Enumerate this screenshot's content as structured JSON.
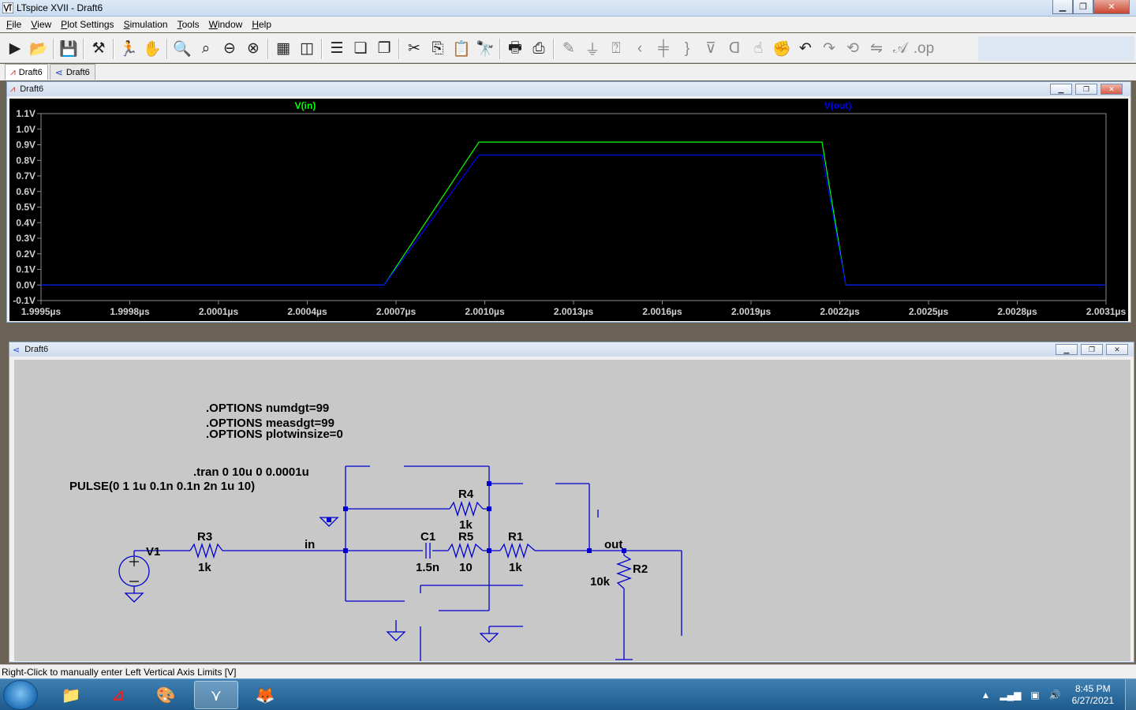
{
  "window": {
    "title": "LTspice XVII - Draft6"
  },
  "menu": [
    {
      "label": "File",
      "key": "F",
      "rest": "ile"
    },
    {
      "label": "View",
      "key": "V",
      "rest": "iew"
    },
    {
      "label": "Plot Settings",
      "key": "P",
      "rest": "lot Settings"
    },
    {
      "label": "Simulation",
      "key": "S",
      "rest": "imulation"
    },
    {
      "label": "Tools",
      "key": "T",
      "rest": "ools"
    },
    {
      "label": "Window",
      "key": "W",
      "rest": "indow"
    },
    {
      "label": "Help",
      "key": "H",
      "rest": "elp"
    }
  ],
  "tabs": [
    {
      "label": "Draft6",
      "icon": "waveform-icon",
      "active": true
    },
    {
      "label": "Draft6",
      "icon": "schematic-icon",
      "active": false
    }
  ],
  "waveform_window": {
    "title": "Draft6"
  },
  "schematic_window": {
    "title": "Draft6"
  },
  "chart_data": {
    "type": "line",
    "title": "",
    "xlabel": "",
    "ylabel": "",
    "series": [
      {
        "name": "V(in)",
        "color": "#00ff00",
        "x": [
          1.9995,
          2.00066,
          2.00098,
          2.00214,
          2.00222,
          2.0031
        ],
        "y": [
          0.0,
          0.0,
          0.917,
          0.917,
          0.0,
          0.0
        ]
      },
      {
        "name": "V(out)",
        "color": "#0000ff",
        "x": [
          1.9995,
          2.00066,
          2.00098,
          2.00214,
          2.00222,
          2.0031
        ],
        "y": [
          0.0,
          0.0,
          0.834,
          0.834,
          0.0,
          0.0
        ]
      }
    ],
    "xlim": [
      1.9995,
      2.0031
    ],
    "ylim": [
      -0.1,
      1.1
    ],
    "x_ticks": [
      "1.9995µs",
      "1.9998µs",
      "2.0001µs",
      "2.0004µs",
      "2.0007µs",
      "2.0010µs",
      "2.0013µs",
      "2.0016µs",
      "2.0019µs",
      "2.0022µs",
      "2.0025µs",
      "2.0028µs",
      "2.0031µs"
    ],
    "x_tick_values": [
      1.9995,
      1.9998,
      2.0001,
      2.0004,
      2.0007,
      2.001,
      2.0013,
      2.0016,
      2.0019,
      2.0022,
      2.0025,
      2.0028,
      2.0031
    ],
    "y_ticks": [
      "1.1V",
      "1.0V",
      "0.9V",
      "0.8V",
      "0.7V",
      "0.6V",
      "0.5V",
      "0.4V",
      "0.3V",
      "0.2V",
      "0.1V",
      "0.0V",
      "-0.1V"
    ],
    "y_tick_values": [
      1.1,
      1.0,
      0.9,
      0.8,
      0.7,
      0.6,
      0.5,
      0.4,
      0.3,
      0.2,
      0.1,
      0.0,
      -0.1
    ],
    "grid": false,
    "legend": "top"
  },
  "schematic": {
    "directives": {
      "opt1": ".OPTIONS numdgt=99",
      "opt2": ".OPTIONS measdgt=99",
      "opt3": ".OPTIONS plotwinsize=0",
      "tran": ".tran 0 10u 0 0.0001u",
      "pulse": "PULSE(0 1 1u 0.1n 0.1n 2n 1u 10)"
    },
    "components": {
      "V1": "V1",
      "R3": "R3",
      "R3_val": "1k",
      "R4": "R4",
      "R4_val": "1k",
      "C1": "C1",
      "C1_val": "1.5n",
      "R5": "R5",
      "R5_val": "10",
      "R1": "R1",
      "R1_val": "1k",
      "R2": "R2",
      "R2_val": "10k"
    },
    "nets": {
      "in": "in",
      "out": "out"
    }
  },
  "status": {
    "text": "Right-Click to manually enter Left Vertical Axis Limits [V]"
  },
  "taskbar": {
    "time": "8:45 PM",
    "date": "6/27/2021"
  }
}
